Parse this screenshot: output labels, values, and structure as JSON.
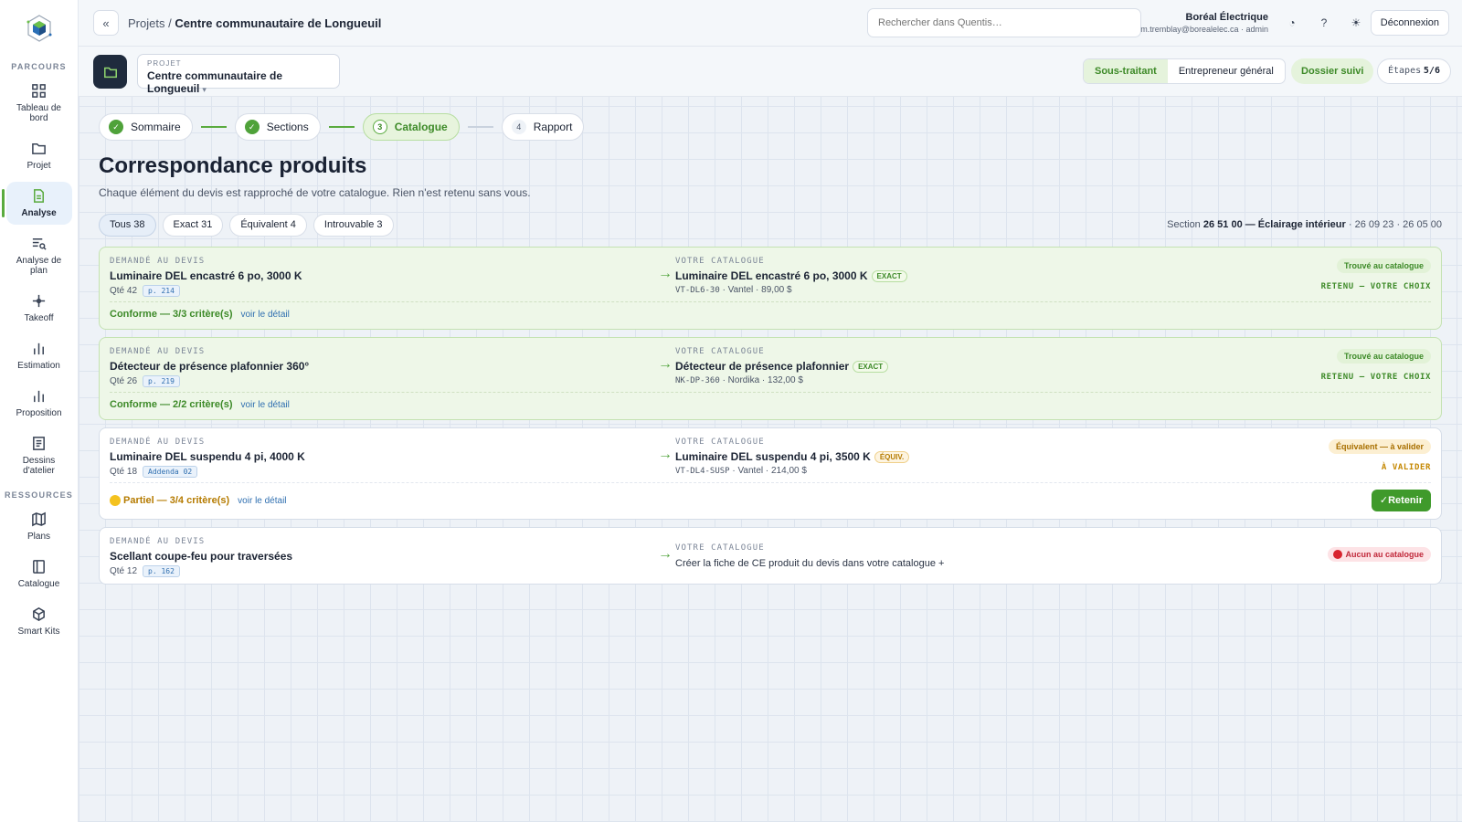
{
  "sidebar": {
    "section_parcours": "PARCOURS",
    "section_ressources": "RESSOURCES",
    "items": [
      {
        "label": "Tableau de bord",
        "icon": "grid-icon"
      },
      {
        "label": "Projet",
        "icon": "folder-icon"
      },
      {
        "label": "Analyse",
        "icon": "document-icon"
      },
      {
        "label": "Analyse de plan",
        "icon": "list-search-icon"
      },
      {
        "label": "Takeoff",
        "icon": "crosshair-icon"
      },
      {
        "label": "Estimation",
        "icon": "bar-chart-icon"
      },
      {
        "label": "Proposition",
        "icon": "bar-chart-icon"
      },
      {
        "label": "Dessins d'atelier",
        "icon": "drawing-icon"
      },
      {
        "label": "Plans",
        "icon": "map-icon"
      },
      {
        "label": "Catalogue",
        "icon": "book-icon"
      },
      {
        "label": "Smart Kits",
        "icon": "cube-icon"
      }
    ],
    "active": "Analyse"
  },
  "topbar": {
    "collapse": "«",
    "crumb_root": "Projets /",
    "crumb_current": "Centre communautaire de Longueuil",
    "search_placeholder": "Rechercher dans Quentis…",
    "company": "Boréal Électrique",
    "user": "m.tremblay@borealelec.ca · admin",
    "logout": "Déconnexion"
  },
  "project": {
    "label": "PROJET",
    "name": "Centre communautaire de Longueuil",
    "caret": "▾",
    "role_sub": "Sous-traitant",
    "role_gen": "Entrepreneur général",
    "followed": "Dossier suivi",
    "steps_label": "Étapes",
    "steps_value": "5/6"
  },
  "stepper": [
    {
      "num": "✓",
      "label": "Sommaire",
      "state": "done"
    },
    {
      "num": "✓",
      "label": "Sections",
      "state": "done"
    },
    {
      "num": "3",
      "label": "Catalogue",
      "state": "current"
    },
    {
      "num": "4",
      "label": "Rapport",
      "state": "todo"
    }
  ],
  "page": {
    "title": "Correspondance produits",
    "subtitle": "Chaque élément du devis est rapproché de votre catalogue. Rien n'est retenu sans vous."
  },
  "filters": [
    "Tous 38",
    "Exact 31",
    "Équivalent 4",
    "Introuvable 3"
  ],
  "section_ref": {
    "prefix": "Section",
    "name": "26 51 00 — Éclairage intérieur",
    "suffix": "· 26 09 23 · 26 05 00"
  },
  "labels": {
    "requested": "DEMANDÉ AU DEVIS",
    "catalog": "VOTRE CATALOGUE",
    "arrow": "→",
    "detail": "voir le détail"
  },
  "rows": [
    {
      "req_name": "Luminaire DEL encastré 6 po, 3000 K",
      "qty": "Qté 42",
      "ref": "p. 214",
      "cat_name": "Luminaire DEL encastré 6 po, 3000 K",
      "cat_badge": "EXACT",
      "cat_code": "VT-DL6-30",
      "cat_meta": "· Vantel · 89,00 $",
      "status": "Trouvé au catalogue",
      "status2": "RETENU — VOTRE CHOIX",
      "criteria": "Conforme — 3/3 critère(s)"
    },
    {
      "req_name": "Détecteur de présence plafonnier 360°",
      "qty": "Qté 26",
      "ref": "p. 219",
      "cat_name": "Détecteur de présence plafonnier",
      "cat_badge": "EXACT",
      "cat_code": "NK-DP-360",
      "cat_meta": "· Nordika · 132,00 $",
      "status": "Trouvé au catalogue",
      "status2": "RETENU — VOTRE CHOIX",
      "criteria": "Conforme — 2/2 critère(s)"
    },
    {
      "req_name": "Luminaire DEL suspendu 4 pi, 4000 K",
      "qty": "Qté 18",
      "ref": "Addenda 02",
      "cat_name": "Luminaire DEL suspendu 4 pi, 3500 K",
      "cat_badge": "ÉQUIV.",
      "cat_code": "VT-DL4-SUSP",
      "cat_meta": "· Vantel · 214,00 $",
      "status": "Équivalent — à valider",
      "status2": "À VALIDER",
      "criteria": "Partiel — 3/4 critère(s)",
      "keep": "✓Retenir"
    },
    {
      "req_name": "Scellant coupe-feu pour traversées",
      "qty": "Qté 12",
      "ref": "p. 162",
      "create": "Créer la fiche de CE produit du devis dans votre catalogue +",
      "status": "Aucun au catalogue"
    }
  ]
}
